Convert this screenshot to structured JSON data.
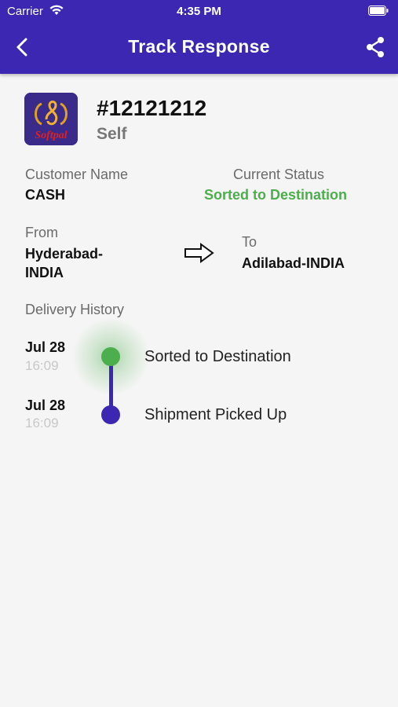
{
  "status_bar": {
    "carrier": "Carrier",
    "time": "4:35 PM"
  },
  "nav": {
    "title": "Track Response"
  },
  "shipment": {
    "number": "#12121212",
    "type": "Self",
    "logo_text": "Softpal"
  },
  "details": {
    "customer_label": "Customer Name",
    "customer_value": "CASH",
    "status_label": "Current Status",
    "status_value": "Sorted to Destination",
    "from_label": "From",
    "from_value_line1": "Hyderabad-",
    "from_value_line2": "INDIA",
    "to_label": "To",
    "to_value": "Adilabad-INDIA"
  },
  "history": {
    "label": "Delivery History",
    "events": [
      {
        "date": "Jul 28",
        "time": "16:09",
        "text": "Sorted to Destination"
      },
      {
        "date": "Jul 28",
        "time": "16:09",
        "text": "Shipment Picked Up"
      }
    ]
  },
  "colors": {
    "primary": "#3b27b2",
    "success": "#4cae4c"
  }
}
